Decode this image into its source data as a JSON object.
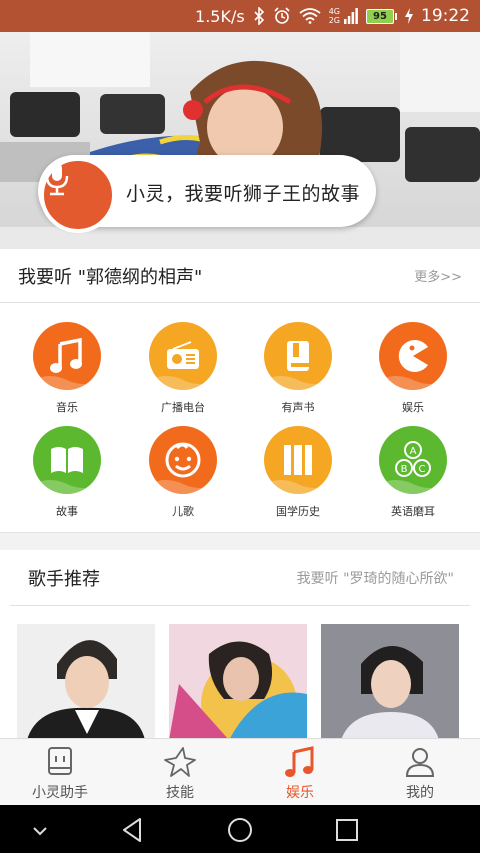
{
  "status_bar": {
    "speed": "1.5K/s",
    "net1": "4G",
    "net2": "2G",
    "battery": "95",
    "time": "19:22"
  },
  "hero": {
    "voice_prompt": "小灵，我要听狮子王的故事"
  },
  "suggestion": {
    "query": "我要听 \"郭德纲的相声\"",
    "more": "更多>>"
  },
  "categories": [
    {
      "label": "音乐",
      "icon": "music-note-icon",
      "color": "#f26b1d"
    },
    {
      "label": "广播电台",
      "icon": "radio-icon",
      "color": "#f5a623"
    },
    {
      "label": "有声书",
      "icon": "book-icon",
      "color": "#f5a623"
    },
    {
      "label": "娱乐",
      "icon": "pacman-icon",
      "color": "#f26b1d"
    },
    {
      "label": "故事",
      "icon": "open-book-icon",
      "color": "#5cb82e"
    },
    {
      "label": "儿歌",
      "icon": "child-face-icon",
      "color": "#f26b1d"
    },
    {
      "label": "国学历史",
      "icon": "scroll-icon",
      "color": "#f5a623"
    },
    {
      "label": "英语磨耳",
      "icon": "abc-icon",
      "color": "#5cb82e"
    }
  ],
  "singers": {
    "title": "歌手推荐",
    "hint": "我要听 \"罗琦的随心所欲\""
  },
  "tabs": [
    {
      "label": "小灵助手",
      "icon": "assistant-icon",
      "active": false
    },
    {
      "label": "技能",
      "icon": "star-icon",
      "active": false
    },
    {
      "label": "娱乐",
      "icon": "music-note-icon",
      "active": true
    },
    {
      "label": "我的",
      "icon": "person-icon",
      "active": false
    }
  ],
  "colors": {
    "accent": "#e8572b",
    "status_bar": "#b35232"
  }
}
